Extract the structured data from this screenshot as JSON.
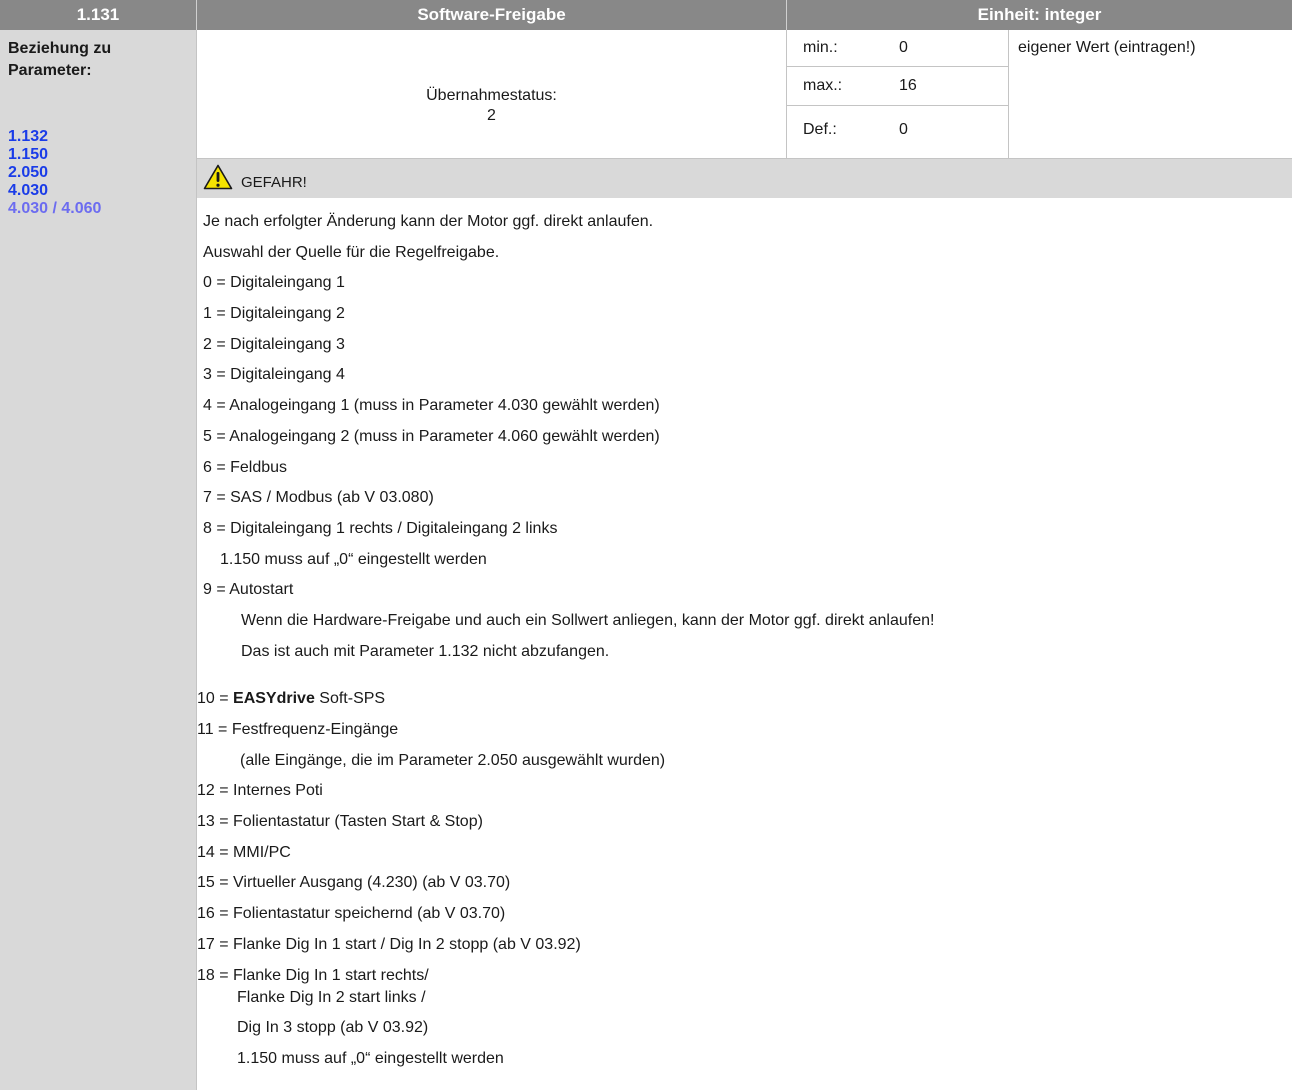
{
  "header": {
    "param_number": "1.131",
    "title": "Software-Freigabe",
    "unit": "Einheit: integer"
  },
  "sidebar": {
    "title": [
      "Beziehung zu",
      "Parameter:"
    ],
    "links": [
      "1.132",
      "1.150",
      "2.050",
      "4.030",
      "4.030 / 4.060"
    ]
  },
  "status": {
    "label": "Übernahmestatus:",
    "value": "2"
  },
  "minmax": {
    "min_label": "min.:",
    "min_value": "0",
    "max_label": "max.:",
    "max_value": "16",
    "def_label": "Def.:",
    "def_value": "0",
    "own_value": "eigener Wert (eintragen!)"
  },
  "warning": {
    "icon": "warning-icon",
    "label": "GEFAHR!"
  },
  "description": {
    "l1": "Je nach erfolgter Änderung kann der Motor ggf. direkt anlaufen.",
    "l2": "Auswahl der Quelle für die Regelfreigabe.",
    "o0": "0 = Digitaleingang 1",
    "o1": "1 = Digitaleingang 2",
    "o2": "2 = Digitaleingang 3",
    "o3": "3 = Digitaleingang 4",
    "o4": "4 = Analogeingang 1 (muss in Parameter 4.030 gewählt werden)",
    "o5": "5 = Analogeingang 2 (muss in Parameter 4.060 gewählt werden)",
    "o6": "6 = Feldbus",
    "o7": "7 = SAS / Modbus (ab V 03.080)",
    "o8": "8 = Digitaleingang 1 rechts / Digitaleingang 2 links",
    "o8a": "1.150 muss auf „0“ eingestellt werden",
    "o9": "9 = Autostart",
    "o9a": "Wenn die Hardware-Freigabe und auch ein Sollwert anliegen, kann der Motor ggf. direkt anlaufen!",
    "o9b": "Das ist auch mit Parameter 1.132 nicht abzufangen.",
    "o10_prefix": "10 = ",
    "o10_brand": "EASYdrive",
    "o10_suffix": " Soft-SPS",
    "o11": "11 = Festfrequenz-Eingänge",
    "o11a": "(alle Eingänge, die im Parameter 2.050 ausgewählt wurden)",
    "o12": "12 = Internes Poti",
    "o13": "13 = Folientastatur (Tasten Start & Stop)",
    "o14": "14 = MMI/PC",
    "o15": "15 = Virtueller Ausgang (4.230) (ab V 03.70)",
    "o16": "16 = Folientastatur speichernd (ab V 03.70)",
    "o17": "17 = Flanke Dig In 1 start / Dig In 2 stopp (ab V 03.92)",
    "o18": "18 = Flanke Dig In 1 start rechts/",
    "o18a": "Flanke Dig In 2 start links /",
    "o18b": "Dig In 3 stopp (ab V 03.92)",
    "o18c": "1.150 muss auf „0“ eingestellt werden"
  }
}
